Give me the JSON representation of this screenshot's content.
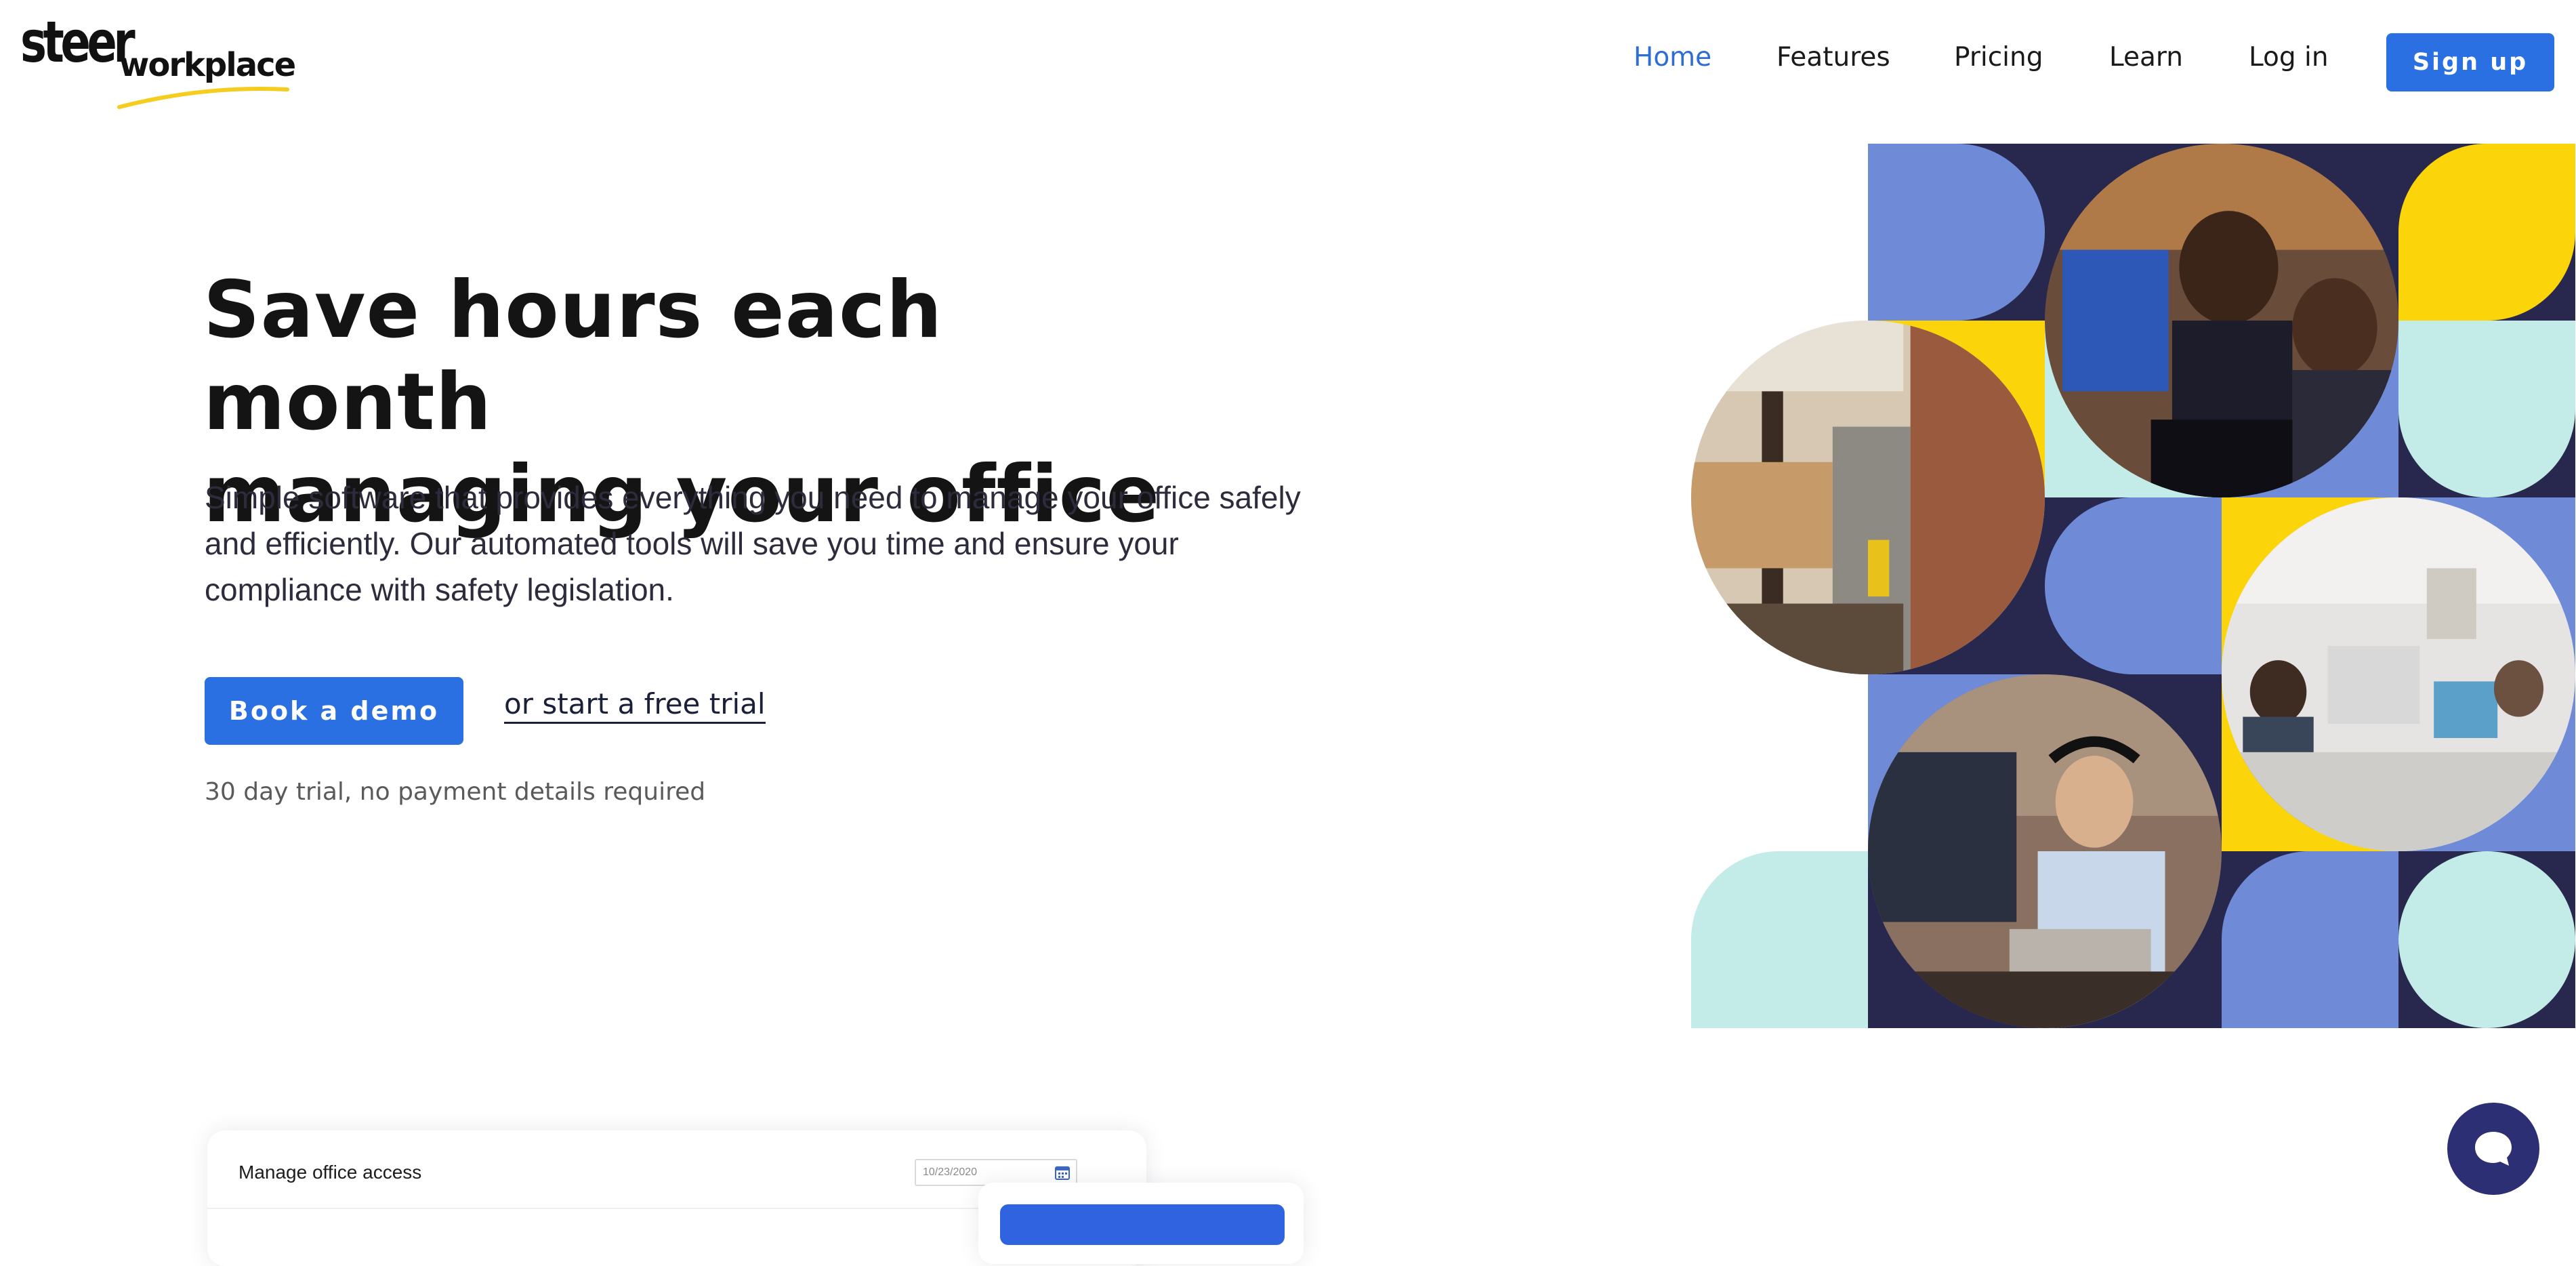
{
  "brand": {
    "logo_main": "steer",
    "logo_sub": "workplace",
    "swoosh_color": "#f5cd1e"
  },
  "nav": {
    "items": [
      {
        "label": "Home",
        "active": true
      },
      {
        "label": "Features",
        "active": false
      },
      {
        "label": "Pricing",
        "active": false
      },
      {
        "label": "Learn",
        "active": false
      },
      {
        "label": "Log in",
        "active": false
      }
    ],
    "signup_label": "Sign up"
  },
  "hero": {
    "title_line1": "Save hours each month",
    "title_line2": "managing your office",
    "subtitle_line1": "Simple software that provides everything you need to manage your office safely",
    "subtitle_line2": "and efficiently. Our automated tools will save you time and ensure your",
    "subtitle_line3": "compliance with safety legislation.",
    "cta_primary": "Book a demo",
    "cta_secondary": "or start a free trial",
    "note": "30 day trial, no payment details required"
  },
  "collage": {
    "colors": {
      "navy": "#28284e",
      "periwinkle": "#6f8bd8",
      "yellow": "#fcd40a",
      "mint": "#c3ebe8"
    },
    "photos": [
      "two-colleagues-at-computer",
      "office-staircase",
      "office-workers-at-desks",
      "man-with-headset-at-computer"
    ]
  },
  "app_preview": {
    "card_title": "Manage office access",
    "date_value": "10/23/2020",
    "calendar_icon": "calendar-icon"
  },
  "colors": {
    "accent": "#2a70e3",
    "nav_active": "#2c6ed5",
    "chat_bubble": "#2c2f73"
  }
}
